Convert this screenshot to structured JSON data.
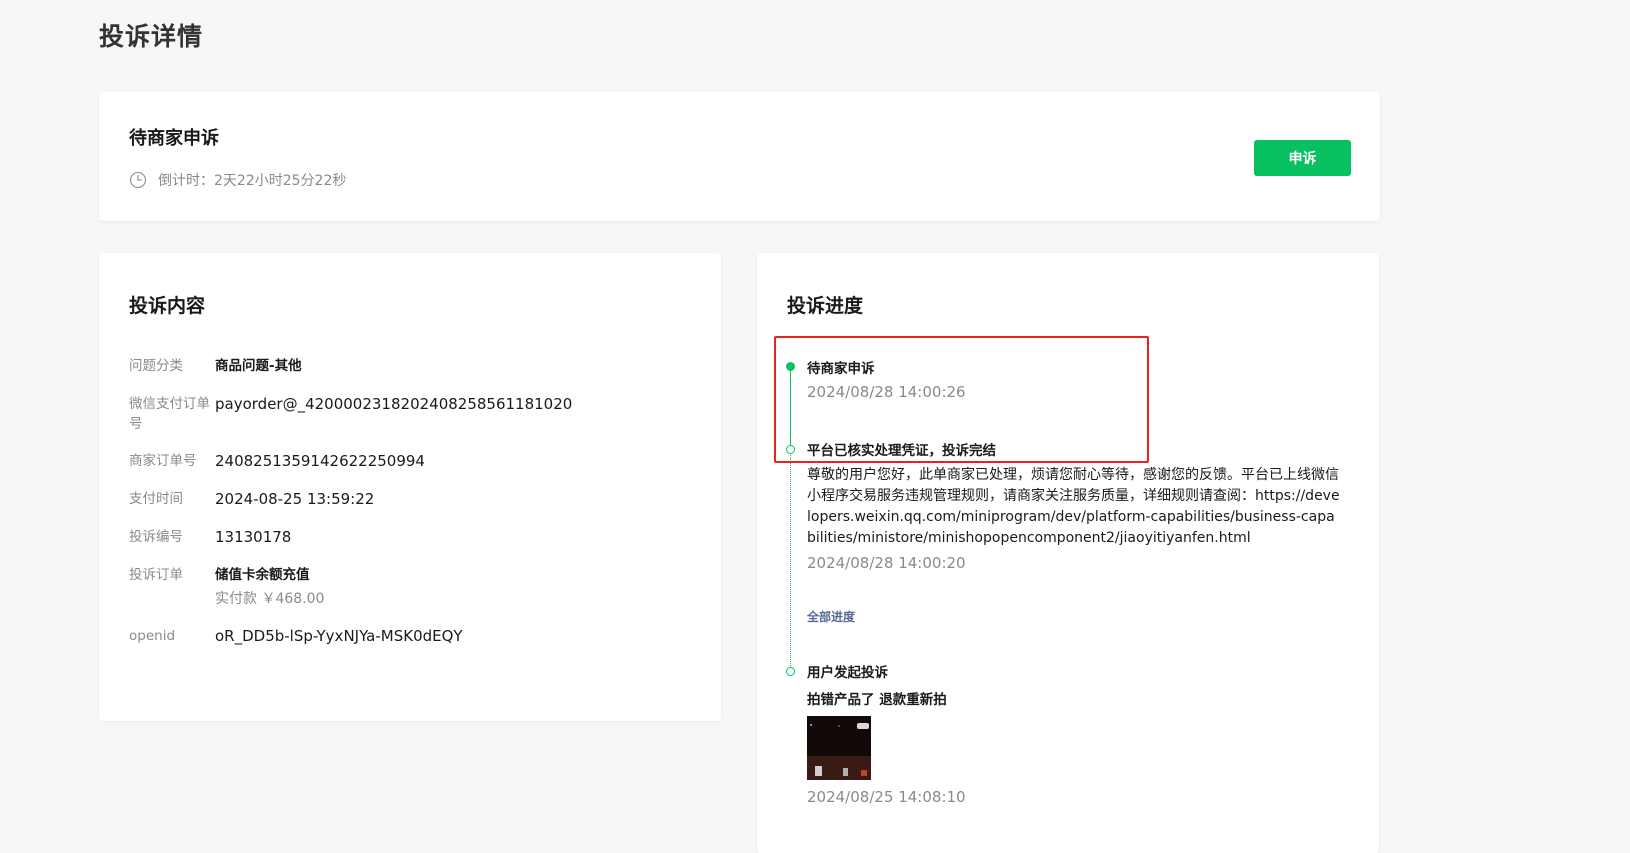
{
  "page": {
    "title": "投诉详情"
  },
  "status": {
    "title": "待商家申诉",
    "countdown_label": "倒计时：",
    "countdown_value": "2天22小时25分22秒",
    "appeal_button": "申诉",
    "icon": "clock-icon"
  },
  "complaint": {
    "heading": "投诉内容",
    "fields": [
      {
        "label": "问题分类",
        "value": "商品问题-其他"
      },
      {
        "label": "微信支付订单号",
        "value": "payorder@_4200002318202408258561181020"
      },
      {
        "label": "商家订单号",
        "value": "2408251359142622250994"
      },
      {
        "label": "支付时间",
        "value": "2024-08-25 13:59:22"
      },
      {
        "label": "投诉编号",
        "value": "13130178"
      },
      {
        "label": "投诉订单",
        "value": "储值卡余额充值",
        "sub": "实付款 ￥468.00"
      },
      {
        "label": "openid",
        "value": "oR_DD5b-lSp-YyxNJYa-MSK0dEQY"
      }
    ]
  },
  "progress": {
    "heading": "投诉进度",
    "events": [
      {
        "title": "待商家申诉",
        "time": "2024/08/28 14:00:26"
      },
      {
        "title": "平台已核实处理凭证，投诉完结",
        "desc": "尊敬的用户您好，此单商家已处理，烦请您耐心等待，感谢您的反馈。平台已上线微信小程序交易服务违规管理规则，请商家关注服务质量，详细规则请查阅：https://developers.weixin.qq.com/miniprogram/dev/platform-capabilities/business-capabilities/ministore/minishopopencomponent2/jiaoyitiyanfen.html",
        "time": "2024/08/28 14:00:20"
      },
      {
        "title": "用户发起投诉",
        "desc": "拍错产品了 退款重新拍",
        "time": "2024/08/25 14:08:10"
      }
    ],
    "all_progress_link": "全部进度"
  },
  "colors": {
    "accent": "#07c160",
    "highlight": "#e8231f",
    "link": "#576b95"
  }
}
